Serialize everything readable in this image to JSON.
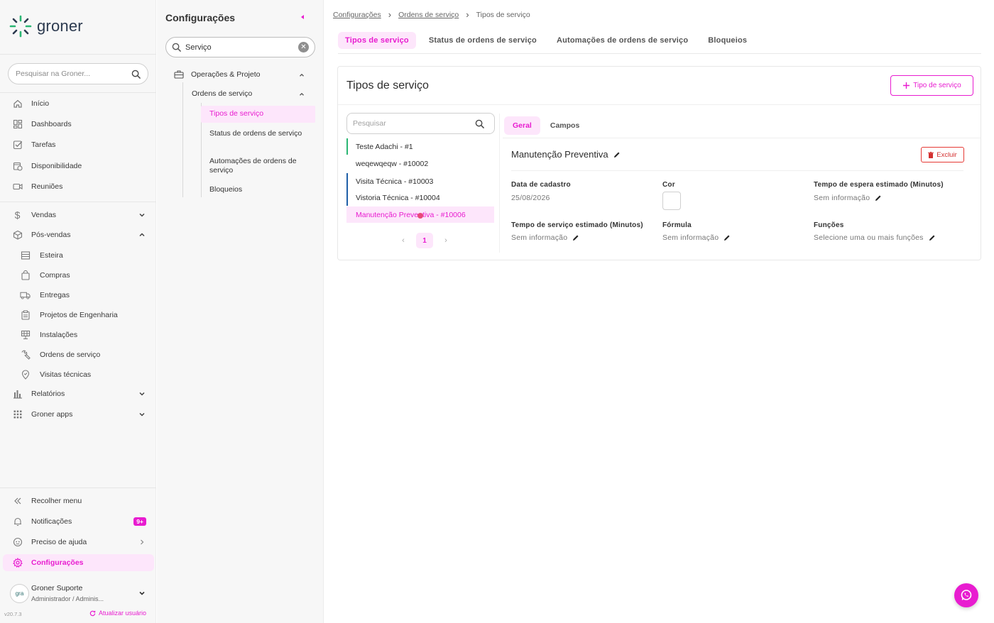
{
  "colors": {
    "accent": "#e81cd0",
    "accent_bg": "#fde6fb",
    "danger": "#d32f2f"
  },
  "sidebar": {
    "logo_text": "groner",
    "search_placeholder": "Pesquisar na Groner...",
    "items": [
      {
        "label": "Início",
        "icon": "home-icon"
      },
      {
        "label": "Dashboards",
        "icon": "dashboard-icon"
      },
      {
        "label": "Tarefas",
        "icon": "checkbox-icon"
      },
      {
        "label": "Disponibilidade",
        "icon": "calendar-clock-icon"
      },
      {
        "label": "Reuniões",
        "icon": "video-icon"
      },
      {
        "label": "Vendas",
        "icon": "dollar-icon"
      },
      {
        "label": "Pós-vendas",
        "icon": "box-icon"
      },
      {
        "label": "Esteira",
        "icon": "list-icon"
      },
      {
        "label": "Compras",
        "icon": "shopping-bag-icon"
      },
      {
        "label": "Entregas",
        "icon": "truck-icon"
      },
      {
        "label": "Projetos de Engenharia",
        "icon": "clipboard-icon"
      },
      {
        "label": "Instalações",
        "icon": "solar-panel-icon"
      },
      {
        "label": "Ordens de serviço",
        "icon": "wrench-icon"
      },
      {
        "label": "Visitas técnicas",
        "icon": "location-icon"
      },
      {
        "label": "Relatórios",
        "icon": "bar-chart-icon"
      },
      {
        "label": "Groner apps",
        "icon": "apps-grid-icon"
      }
    ],
    "bottom": [
      {
        "label": "Recolher menu",
        "icon": "double-chevron-left-icon"
      },
      {
        "label": "Notificações",
        "icon": "bell-icon",
        "badge": "9+"
      },
      {
        "label": "Preciso de ajuda",
        "icon": "help-icon"
      },
      {
        "label": "Configurações",
        "icon": "gear-icon"
      }
    ],
    "user": {
      "name": "Groner Suporte",
      "role": "Administrador / Adminis...",
      "avatar_text": "gra"
    },
    "version": "v20.7.3",
    "update_user": "Atualizar usuário"
  },
  "config": {
    "title": "Configurações",
    "search_value": "Serviço",
    "tree": {
      "group": "Operações & Projeto",
      "subgroup": "Ordens de serviço",
      "items": [
        "Tipos de serviço",
        "Status de ordens de serviço",
        "Automações de ordens de serviço",
        "Bloqueios"
      ]
    }
  },
  "breadcrumb": {
    "items": [
      "Configurações",
      "Ordens de serviço",
      "Tipos de serviço"
    ]
  },
  "tabs": [
    "Tipos de serviço",
    "Status de ordens de serviço",
    "Automações de ordens de serviço",
    "Bloqueios"
  ],
  "card": {
    "title": "Tipos de serviço",
    "add_button": "Tipo de serviço",
    "list_search_placeholder": "Pesquisar",
    "list": [
      {
        "label": "Teste Adachi - #1",
        "color": "#2bb673"
      },
      {
        "label": "weqewqeqw - #10002",
        "color": ""
      },
      {
        "label": "Visita Técnica - #10003",
        "color": "#1f5fa8"
      },
      {
        "label": "Vistoria Técnica - #10004",
        "color": "#1f5fa8"
      },
      {
        "label": "Manutenção Preventiva - #10006",
        "color": ""
      }
    ],
    "page": "1",
    "detail": {
      "tabs": [
        "Geral",
        "Campos"
      ],
      "title": "Manutenção Preventiva",
      "delete_button": "Excluir",
      "fields": {
        "data_cadastro_label": "Data de cadastro",
        "data_cadastro_value": "25/08/2026",
        "cor_label": "Cor",
        "tempo_espera_label": "Tempo de espera estimado (Minutos)",
        "tempo_espera_value": "Sem informação",
        "tempo_servico_label": "Tempo de serviço estimado (Minutos)",
        "tempo_servico_value": "Sem informação",
        "formula_label": "Fórmula",
        "formula_value": "Sem informação",
        "funcoes_label": "Funções",
        "funcoes_value": "Selecione uma ou mais funções"
      }
    }
  }
}
